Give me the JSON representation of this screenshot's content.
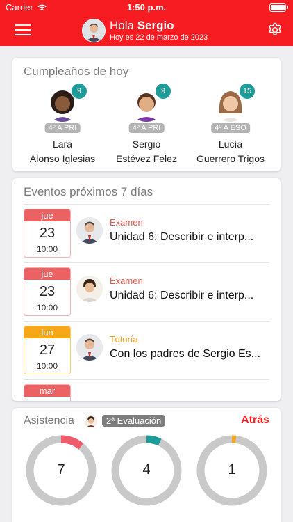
{
  "status": {
    "carrier": "Carrier",
    "time": "1:50 p.m."
  },
  "header": {
    "greeting": "Hola",
    "user_name": "Sergio",
    "date_line": "Hoy es 22 de marzo de 2023"
  },
  "birthdays": {
    "title": "Cumpleaños de hoy",
    "people": [
      {
        "first_name": "Lara",
        "last_name": "Alonso Iglesias",
        "age": "9",
        "grade": "4º A PRI"
      },
      {
        "first_name": "Sergio",
        "last_name": "Estévez Felez",
        "age": "9",
        "grade": "4º A PRI"
      },
      {
        "first_name": "Lucía",
        "last_name": "Guerrero Trigos",
        "age": "15",
        "grade": "4º A ESO"
      }
    ]
  },
  "events": {
    "title": "Eventos próximos 7 días",
    "items": [
      {
        "dow": "jue",
        "day": "23",
        "time": "10:00",
        "type": "Examen",
        "title": "Unidad 6: Describir e interp..."
      },
      {
        "dow": "jue",
        "day": "23",
        "time": "10:00",
        "type": "Examen",
        "title": "Unidad 6: Describir e interp..."
      },
      {
        "dow": "lun",
        "day": "27",
        "time": "10:00",
        "type": "Tutoría",
        "title": "Con los padres de Sergio Es..."
      },
      {
        "dow": "mar",
        "day": "",
        "time": "",
        "type": "",
        "title": ""
      }
    ]
  },
  "attendance": {
    "title": "Asistencia",
    "period": "2ª Evaluación",
    "back_label": "Atrás",
    "donuts": [
      {
        "value": "7",
        "fraction": 0.11,
        "color": "#ef5b6a"
      },
      {
        "value": "4",
        "fraction": 0.07,
        "color": "#1e9c9a"
      },
      {
        "value": "1",
        "fraction": 0.02,
        "color": "#f5a623"
      }
    ]
  },
  "colors": {
    "brand": "#f61c21",
    "teal": "#1e9c9a",
    "orange": "#f6a818"
  }
}
